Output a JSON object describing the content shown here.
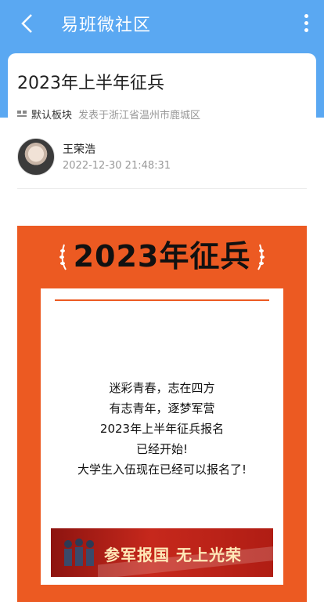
{
  "header": {
    "title": "易班微社区",
    "back_icon": "back-arrow-icon",
    "more_icon": "more-vertical-icon"
  },
  "post": {
    "title": "2023年上半年征兵",
    "board": "默认板块",
    "location": "发表于浙江省温州市鹿城区",
    "author": "王荣浩",
    "time": "2022-12-30 21:48:31"
  },
  "poster": {
    "title": "2023年征兵",
    "lines": [
      "迷彩青春，志在四方",
      "有志青年，逐梦军营",
      "2023年上半年征兵报名",
      "已经开始!",
      "大学生入伍现在已经可以报名了!"
    ],
    "banner": "参军报国 无上光荣"
  },
  "colors": {
    "header": "#5aa8f2",
    "accent": "#ec5a22"
  }
}
